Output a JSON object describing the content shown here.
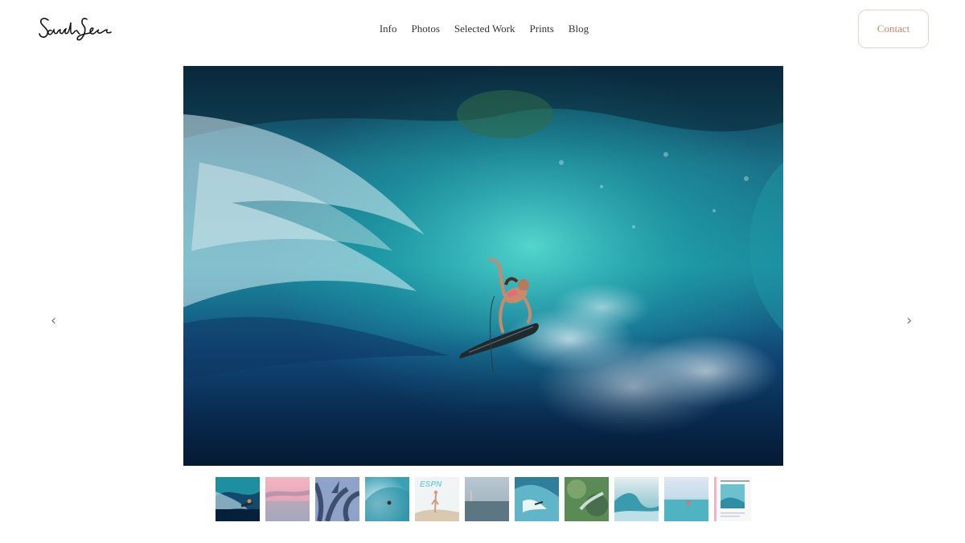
{
  "header": {
    "logo_text": "Sarah Lee",
    "nav": [
      "Info",
      "Photos",
      "Selected Work",
      "Prints",
      "Blog"
    ],
    "contact_label": "Contact"
  },
  "carousel": {
    "prev_icon": "chevron-left-icon",
    "next_icon": "chevron-right-icon",
    "prev_glyph": "‹",
    "next_glyph": "›",
    "selected_index": 0,
    "thumbnail_count": 11,
    "magazine_logo": "ESPN"
  },
  "colors": {
    "accent": "#c8876a",
    "contact_border": "#e8d3c6",
    "text": "#333333",
    "background": "#ffffff"
  }
}
